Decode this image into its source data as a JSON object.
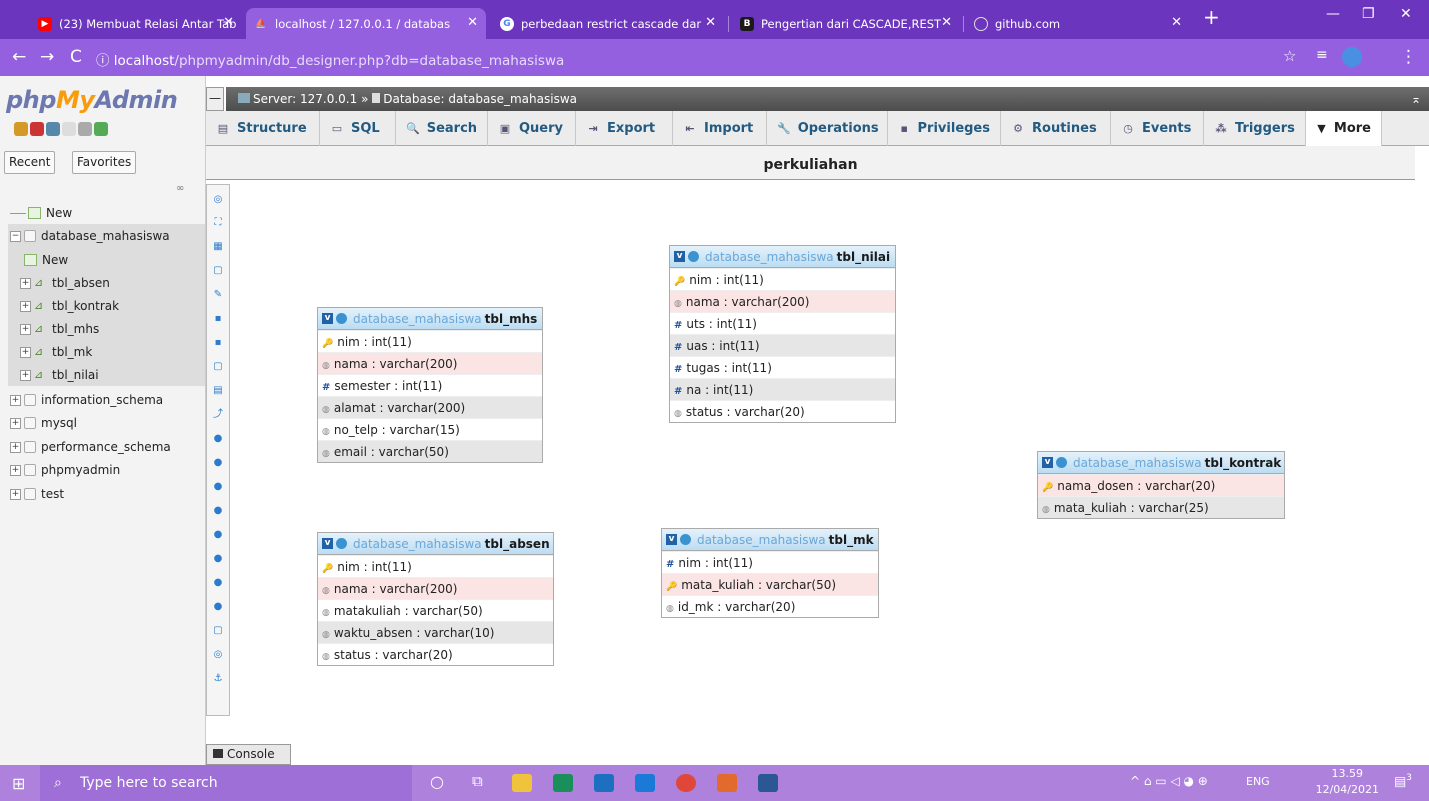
{
  "browser": {
    "tabs": [
      {
        "label": "(23) Membuat Relasi Antar Tab",
        "favicon": "youtube-icon"
      },
      {
        "label": "localhost / 127.0.0.1 / databas",
        "favicon": "phpmyadmin-icon"
      },
      {
        "label": "perbedaan restrict cascade dar",
        "favicon": "google-icon"
      },
      {
        "label": "Pengertian dari CASCADE,REST",
        "favicon": "blogger-icon"
      },
      {
        "label": "github.com",
        "favicon": "globe-icon"
      }
    ],
    "url_host": "localhost",
    "url_path": "/phpmyadmin/db_designer.php?db=database_mahasiswa"
  },
  "pma": {
    "logo_a": "php",
    "logo_b": "My",
    "logo_c": "Admin",
    "recent": "Recent",
    "favorites": "Favorites",
    "tree": {
      "new": "New",
      "db": "database_mahasiswa",
      "db_new": "New",
      "tables": [
        "tbl_absen",
        "tbl_kontrak",
        "tbl_mhs",
        "tbl_mk",
        "tbl_nilai"
      ],
      "others": [
        "information_schema",
        "mysql",
        "performance_schema",
        "phpmyadmin",
        "test"
      ]
    },
    "server_breadcrumb": "Server: 127.0.0.1 » ",
    "db_breadcrumb": "Database: database_mahasiswa",
    "tabs": [
      "Structure",
      "SQL",
      "Search",
      "Query",
      "Export",
      "Import",
      "Operations",
      "Privileges",
      "Routines",
      "Events",
      "Triggers",
      "More"
    ],
    "page_title": "perkuliahan",
    "console": "Console"
  },
  "designer": {
    "db": "database_mahasiswa",
    "tables": [
      {
        "name": "tbl_mhs",
        "columns": [
          {
            "t": "k",
            "c": "nim : int(11)"
          },
          {
            "t": "s",
            "c": "nama : varchar(200)"
          },
          {
            "t": "h",
            "c": "semester : int(11)"
          },
          {
            "t": "s",
            "c": "alamat : varchar(200)"
          },
          {
            "t": "s",
            "c": "no_telp : varchar(15)"
          },
          {
            "t": "s",
            "c": "email : varchar(50)"
          }
        ]
      },
      {
        "name": "tbl_nilai",
        "columns": [
          {
            "t": "k",
            "c": "nim : int(11)"
          },
          {
            "t": "s",
            "c": "nama : varchar(200)"
          },
          {
            "t": "h",
            "c": "uts : int(11)"
          },
          {
            "t": "h",
            "c": "uas : int(11)"
          },
          {
            "t": "h",
            "c": "tugas : int(11)"
          },
          {
            "t": "h",
            "c": "na : int(11)"
          },
          {
            "t": "s",
            "c": "status : varchar(20)"
          }
        ]
      },
      {
        "name": "tbl_kontrak",
        "columns": [
          {
            "t": "k",
            "c": "nama_dosen : varchar(20)"
          },
          {
            "t": "s",
            "c": "mata_kuliah : varchar(25)"
          }
        ]
      },
      {
        "name": "tbl_absen",
        "columns": [
          {
            "t": "k",
            "c": "nim : int(11)"
          },
          {
            "t": "s",
            "c": "nama : varchar(200)"
          },
          {
            "t": "s",
            "c": "matakuliah : varchar(50)"
          },
          {
            "t": "s",
            "c": "waktu_absen : varchar(10)"
          },
          {
            "t": "s",
            "c": "status : varchar(20)"
          }
        ]
      },
      {
        "name": "tbl_mk",
        "columns": [
          {
            "t": "h",
            "c": "nim : int(11)"
          },
          {
            "t": "k",
            "c": "mata_kuliah : varchar(50)"
          },
          {
            "t": "s",
            "c": "id_mk : varchar(20)"
          }
        ]
      }
    ]
  },
  "taskbar": {
    "search_placeholder": "Type here to search",
    "lang": "ENG",
    "time": "13.59",
    "date": "12/04/2021",
    "notif": "3"
  }
}
